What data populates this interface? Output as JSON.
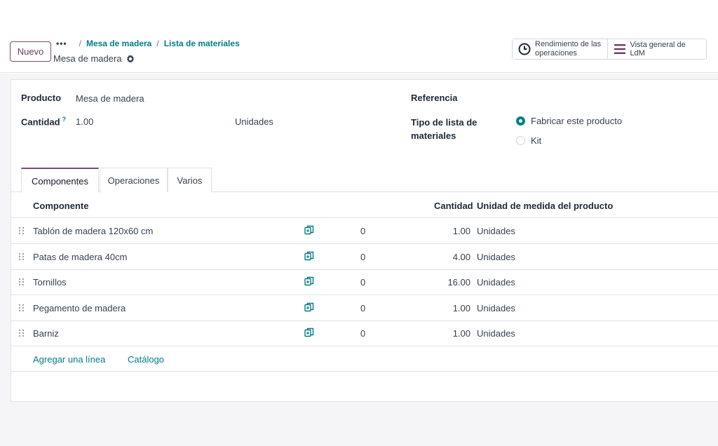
{
  "toolbar": {
    "new_label": "Nuevo"
  },
  "breadcrumb": {
    "dots": "•••",
    "sep": "/",
    "items": [
      "Mesa de madera",
      "Lista de materiales"
    ]
  },
  "record": {
    "title": "Mesa de madera"
  },
  "smart_buttons": {
    "operations": {
      "line1": "Rendimiento de las",
      "line2": "operaciones",
      "icon": "clock-icon"
    },
    "overview": {
      "label": "Vista general de LdM",
      "icon": "bars-icon"
    }
  },
  "form": {
    "producto_label": "Producto",
    "producto_value": "Mesa de madera",
    "cantidad_label": "Cantidad",
    "cantidad_help": "?",
    "cantidad_value": "1.00",
    "cantidad_uom": "Unidades",
    "referencia_label": "Referencia",
    "tipo_label_1": "Tipo de lista de",
    "tipo_label_2": "materiales",
    "tipo_options": [
      "Fabricar este producto",
      "Kit"
    ],
    "tipo_selected": "Fabricar este producto"
  },
  "tabs": [
    "Componentes",
    "Operaciones",
    "Varios"
  ],
  "active_tab": "Componentes",
  "table": {
    "headers": {
      "component": "Componente",
      "quantity": "Cantidad",
      "uom": "Unidad de medida del producto"
    },
    "rows": [
      {
        "component": "Tablón de madera 120x60 cm",
        "extra": "0",
        "quantity": "1.00",
        "uom": "Unidades"
      },
      {
        "component": "Patas de madera 40cm",
        "extra": "0",
        "quantity": "4.00",
        "uom": "Unidades"
      },
      {
        "component": "Tornillos",
        "extra": "0",
        "quantity": "16.00",
        "uom": "Unidades"
      },
      {
        "component": "Pegamento de madera",
        "extra": "0",
        "quantity": "1.00",
        "uom": "Unidades"
      },
      {
        "component": "Barniz",
        "extra": "0",
        "quantity": "1.00",
        "uom": "Unidades"
      }
    ],
    "add_line": "Agregar una línea",
    "catalog": "Catálogo"
  },
  "colors": {
    "accent": "#017e84",
    "brand": "#7c4a6e"
  }
}
